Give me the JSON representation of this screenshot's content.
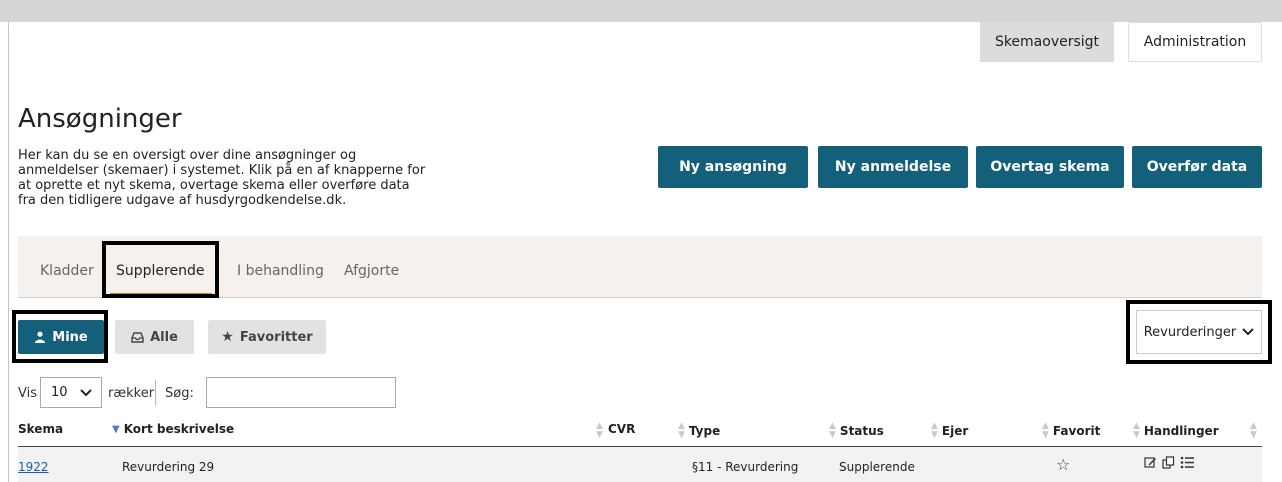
{
  "topnav": {
    "skemaoversigt": "Skemaoversigt",
    "administration": "Administration"
  },
  "page": {
    "title": "Ansøgninger",
    "intro": "Her kan du se en oversigt over dine ansøgninger og anmeldelser (skemaer) i systemet. Klik på en af knapperne for at oprette et nyt skema, overtage skema eller overføre data fra den tidligere udgave af husdyrgodkendelse.dk."
  },
  "actions": {
    "ny_ansogning": "Ny ansøgning",
    "ny_anmeldelse": "Ny anmeldelse",
    "overtag_skema": "Overtag skema",
    "overfor_data": "Overfør data"
  },
  "tabs": [
    "Kladder",
    "Supplerende",
    "I behandling",
    "Afgjorte"
  ],
  "active_tab": "Supplerende",
  "filters": {
    "mine": "Mine",
    "alle": "Alle",
    "favoritter": "Favoritter"
  },
  "revurderinger": "Revurderinger",
  "table_controls": {
    "vis": "Vis",
    "page_size": "10",
    "raekker": "rækker",
    "sog": "Søg:",
    "search_value": ""
  },
  "table": {
    "headers": [
      "Skema",
      "Kort beskrivelse",
      "CVR",
      "Type",
      "Status",
      "Ejer",
      "Favorit",
      "Handlinger"
    ],
    "rows": [
      {
        "skema": "1922",
        "beskrivelse": "Revurdering 29",
        "cvr": "",
        "type": "§11 - Revurdering",
        "status": "Supplerende",
        "ejer": ""
      }
    ]
  },
  "colors": {
    "primary": "#14607a",
    "tab_accent": "#e07b24",
    "link": "#1a5fa8"
  }
}
